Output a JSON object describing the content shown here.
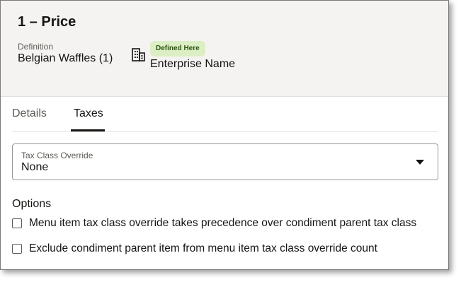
{
  "header": {
    "title": "1 – Price",
    "definition_label": "Definition",
    "definition_value": "Belgian Waffles (1)",
    "badge": "Defined Here",
    "enterprise": "Enterprise Name",
    "icon": "building-icon"
  },
  "tabs": [
    {
      "label": "Details",
      "selected": false
    },
    {
      "label": "Taxes",
      "selected": true
    }
  ],
  "tax_class": {
    "label": "Tax Class Override",
    "value": "None"
  },
  "options": {
    "heading": "Options",
    "items": [
      {
        "label": "Menu item tax class override takes precedence over condiment parent tax class",
        "checked": false
      },
      {
        "label": "Exclude condiment parent item from menu item tax class override count",
        "checked": false
      }
    ]
  },
  "colors": {
    "header_bg": "#f5f3f1",
    "badge_bg": "#dcefc4",
    "badge_text": "#2f5416",
    "text": "#161513"
  }
}
